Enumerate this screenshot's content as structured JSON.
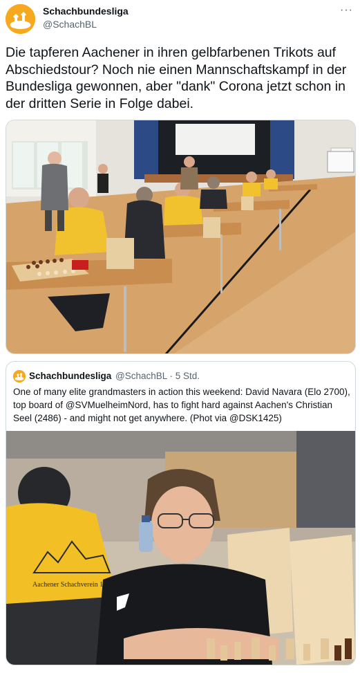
{
  "tweet": {
    "author_name": "Schachbundesliga",
    "author_handle": "@SchachBL",
    "more_label": "···",
    "text": "Die tapferen Aachener in ihren gelbfarbenen Trikots auf Abschiedstour? Noch nie einen Mannschaftskampf in der Bundesliga gewonnen, aber \"dank\" Corona jetzt schon in der dritten Serie in Folge dabei."
  },
  "quote": {
    "author_name": "Schachbundesliga",
    "author_handle": "@SchachBL · 5 Std.",
    "text": "One of many elite grandmasters in action this weekend: David Navara (Elo 2700), top board of @SVMuelheimNord, has to fight hard against Aachen's Christian Seel (2486) - and might not get anywhere. (Phot via @DSK1425)"
  },
  "media": {
    "shirt_text": "Aachener Schachverein 18"
  },
  "colors": {
    "text": "#0f1419",
    "secondary": "#536471",
    "border": "#cfd9de",
    "brand": "#f6a81f"
  }
}
